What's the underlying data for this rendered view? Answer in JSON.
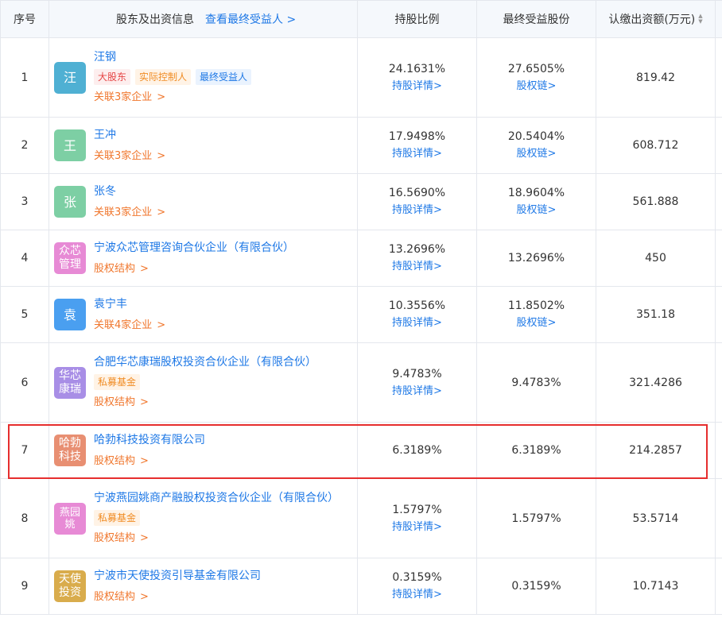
{
  "header": {
    "index": "序号",
    "info": "股东及出资信息",
    "info_link": "查看最终受益人 >",
    "ratio": "持股比例",
    "final": "最终受益股份",
    "capital": "认缴出资额(万元)"
  },
  "rows": [
    {
      "index": "1",
      "avatar": "汪",
      "avatar_color": "#4fb0d3",
      "name": "汪钢",
      "tags": [
        {
          "text": "大股东",
          "kind": "red"
        },
        {
          "text": "实际控制人",
          "kind": "orange"
        },
        {
          "text": "最终受益人",
          "kind": "blue"
        }
      ],
      "assoc": "关联3家企业",
      "ratio": "24.1631%",
      "ratio_link": "持股详情>",
      "final": "27.6505%",
      "final_link": "股权链>",
      "capital": "819.42"
    },
    {
      "index": "2",
      "avatar": "王",
      "avatar_color": "#7dcfa4",
      "name": "王冲",
      "tags": [],
      "assoc": "关联3家企业",
      "ratio": "17.9498%",
      "ratio_link": "持股详情>",
      "final": "20.5404%",
      "final_link": "股权链>",
      "capital": "608.712"
    },
    {
      "index": "3",
      "avatar": "张",
      "avatar_color": "#7dcfa4",
      "name": "张冬",
      "tags": [],
      "assoc": "关联3家企业",
      "ratio": "16.5690%",
      "ratio_link": "持股详情>",
      "final": "18.9604%",
      "final_link": "股权链>",
      "capital": "561.888"
    },
    {
      "index": "4",
      "avatar": "众芯管理",
      "avatar_color": "#e78ad5",
      "name": "宁波众芯管理咨询合伙企业（有限合伙）",
      "tags": [],
      "assoc": "股权结构",
      "ratio": "13.2696%",
      "ratio_link": "持股详情>",
      "final": "13.2696%",
      "final_link": "",
      "capital": "450"
    },
    {
      "index": "5",
      "avatar": "袁",
      "avatar_color": "#4a9ff0",
      "name": "袁宁丰",
      "tags": [],
      "assoc": "关联4家企业",
      "ratio": "10.3556%",
      "ratio_link": "持股详情>",
      "final": "11.8502%",
      "final_link": "股权链>",
      "capital": "351.18"
    },
    {
      "index": "6",
      "avatar": "华芯康瑞",
      "avatar_color": "#a88ee6",
      "name": "合肥华芯康瑞股权投资合伙企业（有限合伙）",
      "tags": [
        {
          "text": "私募基金",
          "kind": "orange"
        }
      ],
      "assoc": "股权结构",
      "ratio": "9.4783%",
      "ratio_link": "持股详情>",
      "final": "9.4783%",
      "final_link": "",
      "capital": "321.4286"
    },
    {
      "index": "7",
      "avatar": "哈勃科技",
      "avatar_color": "#e88f72",
      "name": "哈勃科技投资有限公司",
      "tags": [],
      "assoc": "股权结构",
      "ratio": "6.3189%",
      "ratio_link": "",
      "final": "6.3189%",
      "final_link": "",
      "capital": "214.2857"
    },
    {
      "index": "8",
      "avatar": "燕园姚",
      "avatar_color": "#e78ad5",
      "name": "宁波燕园姚商产融股权投资合伙企业（有限合伙）",
      "tags": [
        {
          "text": "私募基金",
          "kind": "orange"
        }
      ],
      "assoc": "股权结构",
      "ratio": "1.5797%",
      "ratio_link": "持股详情>",
      "final": "1.5797%",
      "final_link": "",
      "capital": "53.5714"
    },
    {
      "index": "9",
      "avatar": "天使投资",
      "avatar_color": "#d9ac4c",
      "name": "宁波市天使投资引导基金有限公司",
      "tags": [],
      "assoc": "股权结构",
      "ratio": "0.3159%",
      "ratio_link": "持股详情>",
      "final": "0.3159%",
      "final_link": "",
      "capital": "10.7143"
    }
  ],
  "icons": {
    "sort": "sort-icon",
    "chevron": "chevron-right-icon"
  },
  "highlight_color": "#e62e2e"
}
